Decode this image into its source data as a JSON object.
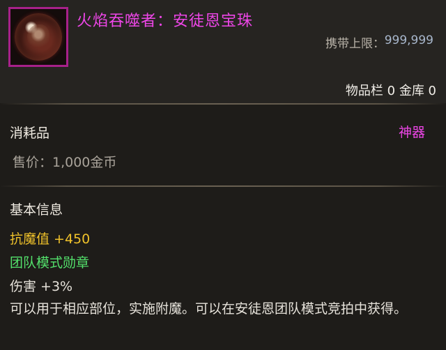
{
  "item": {
    "title": "火焰吞噬者：安徒恩宝珠",
    "carry_limit_label": "携带上限：",
    "carry_limit_value": "999,999",
    "storage": "物品栏 0 金库 0",
    "category": "消耗品",
    "rarity": "神器",
    "price": "售价：1,000金币",
    "basic_info_heading": "基本信息",
    "stats": [
      "抗魔值 +450",
      "团队模式勋章",
      "伤害 +3%"
    ],
    "description": "可以用于相应部位，实施附魔。可以在安徒恩团队模式竞拍中获得。"
  },
  "colors": {
    "rarity": "#ee46e8",
    "stat_gold": "#f0c22a",
    "stat_green": "#53e06b"
  },
  "icons": {
    "item_icon": "red-orb-icon"
  }
}
